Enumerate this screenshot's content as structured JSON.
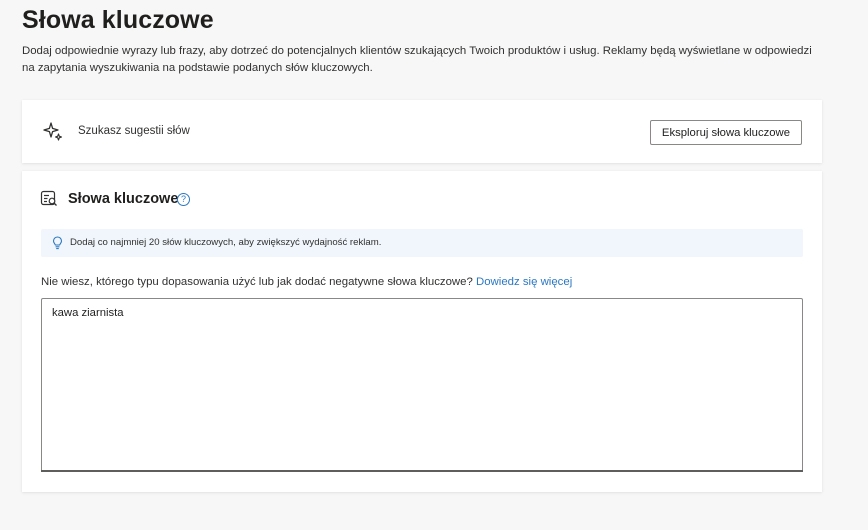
{
  "header": {
    "title": "Słowa kluczowe",
    "description": "Dodaj odpowiednie wyrazy lub frazy, aby dotrzeć do potencjalnych klientów szukających Twoich produktów i usług. Reklamy będą wyświetlane w odpowiedzi na zapytania wyszukiwania na podstawie podanych słów kluczowych."
  },
  "suggest_card": {
    "icon": "sparkle-icon",
    "label": "Szukasz sugestii słów",
    "button_label": "Eksploruj słowa kluczowe"
  },
  "keywords_card": {
    "icon": "keyword-list-icon",
    "title": "Słowa kluczowe",
    "help_glyph": "?",
    "info": {
      "icon": "lightbulb-icon",
      "text": "Dodaj co najmniej 20 słów kluczowych, aby zwiększyć wydajność reklam."
    },
    "hint_text": "Nie wiesz, którego typu dopasowania użyć lub jak dodać negatywne słowa kluczowe?",
    "hint_link": "Dowiedz się więcej",
    "textarea_value": "kawa ziarnista"
  },
  "colors": {
    "link": "#2b78c2",
    "info_background": "#f0f6fb",
    "page_background": "#f7f7f7"
  }
}
